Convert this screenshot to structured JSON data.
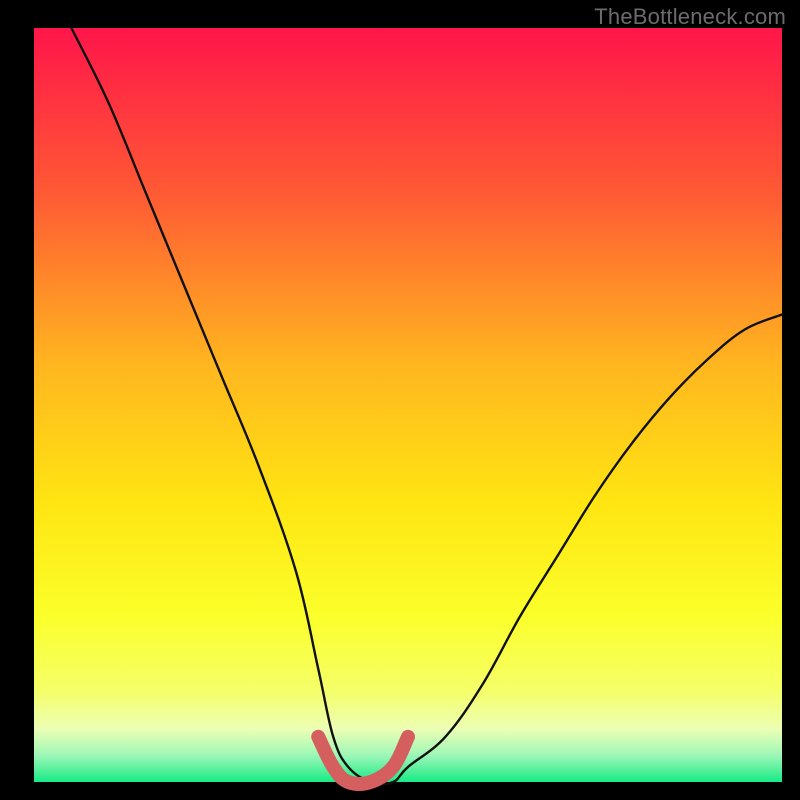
{
  "watermark": "TheBottleneck.com",
  "colors": {
    "bg_black": "#000000",
    "grad_top": "#ff154a",
    "grad_mid1": "#ff6a2e",
    "grad_mid2": "#ffb71f",
    "grad_mid3": "#ffe512",
    "grad_mid4": "#fbff2a",
    "grad_bottom_yellow": "#f5ff6a",
    "grad_bottom_pale": "#ecffb5",
    "grad_bottom_green": "#17eb85",
    "curve_stroke": "#111111",
    "accent_stroke": "#d55f5f"
  },
  "chart_data": {
    "type": "line",
    "title": "",
    "xlabel": "",
    "ylabel": "",
    "xlim": [
      0,
      100
    ],
    "ylim": [
      0,
      100
    ],
    "series": [
      {
        "name": "bottleneck-curve",
        "x": [
          5,
          10,
          15,
          20,
          25,
          30,
          35,
          38,
          40,
          42,
          45,
          48,
          50,
          55,
          60,
          65,
          70,
          75,
          80,
          85,
          90,
          95,
          100
        ],
        "values": [
          100,
          90,
          78,
          66,
          54,
          42,
          28,
          15,
          6,
          2,
          0,
          0,
          2,
          6,
          13,
          22,
          30,
          38,
          45,
          51,
          56,
          60,
          62
        ]
      }
    ],
    "accent_segment": {
      "name": "valley-highlight",
      "x": [
        38,
        40,
        42,
        45,
        48,
        50
      ],
      "values": [
        6,
        2,
        0,
        0,
        2,
        6
      ]
    },
    "legend": false,
    "grid": false
  }
}
